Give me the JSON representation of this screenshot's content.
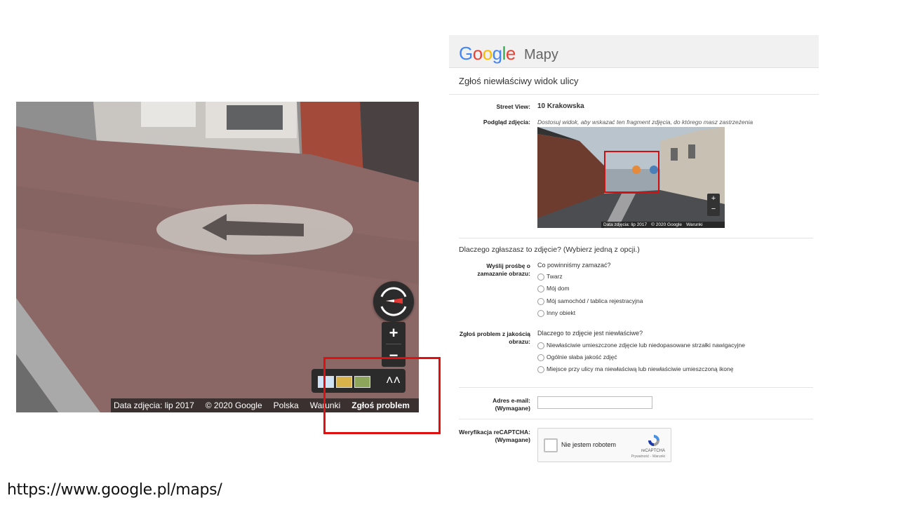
{
  "street_view": {
    "footer": {
      "date": "Data zdjęcia: lip 2017",
      "copyright": "© 2020 Google",
      "country": "Polska",
      "terms": "Warunki",
      "report": "Zgłoś problem"
    },
    "zoom_in": "+",
    "zoom_out": "−",
    "expand": "˄˄",
    "icons": [
      "compass-icon",
      "chevron-up-icon"
    ]
  },
  "form": {
    "brand": "Google",
    "product": "Mapy",
    "title": "Zgłoś niewłaściwy widok ulicy",
    "street_view_label": "Street View:",
    "street_view_value": "10 Krakowska",
    "preview_label": "Podgląd zdjęcia:",
    "preview_hint": "Dostosuj widok, aby wskazać ten fragment zdjęcia, do którego masz zastrzeżenia",
    "preview_footer": {
      "date": "Data zdjęcia: lip 2017",
      "copyright": "© 2020 Google",
      "terms": "Warunki"
    },
    "question": "Dlaczego zgłaszasz to zdjęcie?  (Wybierz jedną z opcji.)",
    "blur_label_1": "Wyślij prośbę o",
    "blur_label_2": "zamazanie obrazu:",
    "blur_question": "Co powinniśmy zamazać?",
    "blur_options": [
      "Twarz",
      "Mój dom",
      "Mój samochód / tablica rejestracyjna",
      "Inny obiekt"
    ],
    "quality_label_1": "Zgłoś problem z jakością",
    "quality_label_2": "obrazu:",
    "quality_question": "Dlaczego to zdjęcie jest niewłaściwe?",
    "quality_options": [
      "Niewłaściwie umieszczone zdjęcie lub niedopasowane strzałki nawigacyjne",
      "Ogólnie słaba jakość zdjęć",
      "Miejsce przy ulicy ma niewłaściwą lub niewłaściwie umieszczoną ikonę"
    ],
    "email_label_1": "Adres e-mail:",
    "email_label_2": "(Wymagane)",
    "email_value": "",
    "captcha_label_1": "Weryfikacja reCAPTCHA:",
    "captcha_label_2": "(Wymagane)",
    "captcha_text": "Nie jestem robotem",
    "captcha_brand": "reCAPTCHA",
    "captcha_links": "Prywatność - Warunki"
  },
  "url": "https://www.google.pl/maps/",
  "colors": {
    "highlight": "#e01010",
    "google_blue": "#4285f4",
    "google_red": "#ea4335",
    "google_yellow": "#fbbc05",
    "google_green": "#34a853"
  }
}
